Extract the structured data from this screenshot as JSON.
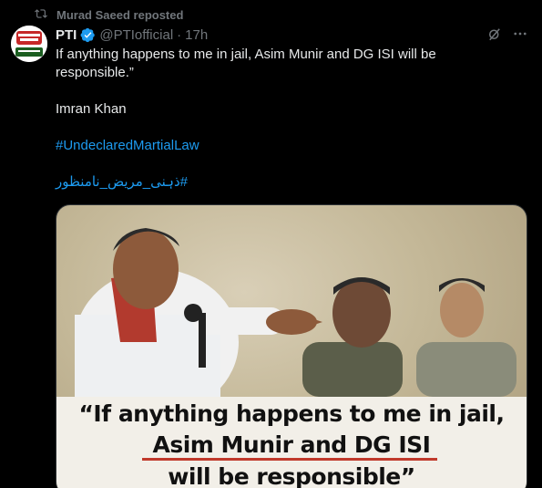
{
  "repost": {
    "label": "Murad Saeed reposted",
    "icon": "repost-icon"
  },
  "post": {
    "author_name": "PTI",
    "handle": "@PTIofficial",
    "separator": "·",
    "time": "17h",
    "verified_color": "#1d9bf0",
    "quote": "If anything happens to me in jail, Asim Munir and DG ISI will be responsible.”",
    "attribution": "Imran Khan",
    "hashtags": [
      "#UndeclaredMartialLaw",
      "#ذہنی_مریض_نامنظور"
    ]
  },
  "actions": {
    "grok_icon": "grok-icon",
    "more_icon": "more-icon"
  },
  "media": {
    "quote_lines": [
      "“If anything happens to me in jail,",
      "Asim Munir and DG ISI",
      "will be responsible”"
    ],
    "underline_color": "#c0392b"
  },
  "colors": {
    "background": "#000000",
    "text": "#e7e9ea",
    "muted": "#71767b",
    "link": "#1d9bf0"
  }
}
